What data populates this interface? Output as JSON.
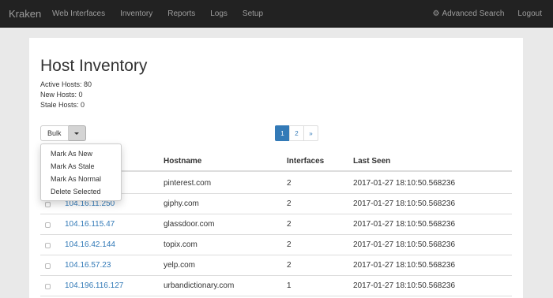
{
  "navbar": {
    "brand": "Kraken",
    "links": [
      "Web Interfaces",
      "Inventory",
      "Reports",
      "Logs",
      "Setup"
    ],
    "advanced_search": "Advanced Search",
    "logout": "Logout",
    "color": "#222222"
  },
  "page": {
    "title": "Host Inventory",
    "stats": [
      "Active Hosts: 80",
      "New Hosts: 0",
      "Stale Hosts: 0"
    ]
  },
  "bulk": {
    "label": "Bulk",
    "menu": [
      "Mark As New",
      "Mark As Stale",
      "Mark As Normal",
      "Delete Selected"
    ]
  },
  "pagination": {
    "pages": [
      "1",
      "2"
    ],
    "next": "»",
    "active": "1",
    "accent": "#337ab7"
  },
  "table": {
    "headers": [
      "",
      "",
      "Hostname",
      "Interfaces",
      "Last Seen"
    ],
    "rows": [
      {
        "ip": "",
        "hostname": "pinterest.com",
        "interfaces": "2",
        "last_seen": "2017-01-27 18:10:50.568236"
      },
      {
        "ip": "104.16.11.250",
        "hostname": "giphy.com",
        "interfaces": "2",
        "last_seen": "2017-01-27 18:10:50.568236"
      },
      {
        "ip": "104.16.115.47",
        "hostname": "glassdoor.com",
        "interfaces": "2",
        "last_seen": "2017-01-27 18:10:50.568236"
      },
      {
        "ip": "104.16.42.144",
        "hostname": "topix.com",
        "interfaces": "2",
        "last_seen": "2017-01-27 18:10:50.568236"
      },
      {
        "ip": "104.16.57.23",
        "hostname": "yelp.com",
        "interfaces": "2",
        "last_seen": "2017-01-27 18:10:50.568236"
      },
      {
        "ip": "104.196.116.127",
        "hostname": "urbandictionary.com",
        "interfaces": "1",
        "last_seen": "2017-01-27 18:10:50.568236"
      }
    ]
  }
}
